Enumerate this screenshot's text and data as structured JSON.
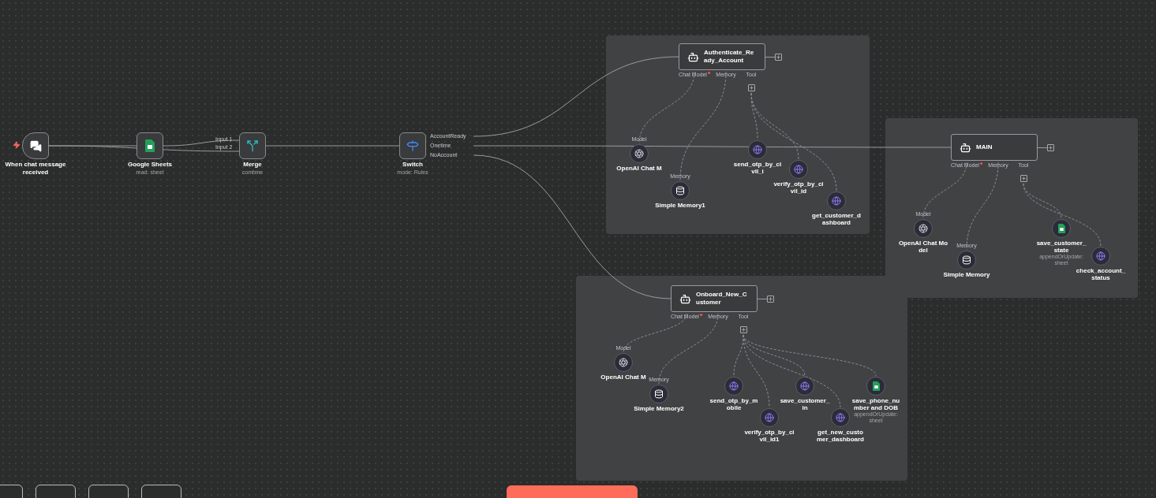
{
  "flow_nodes": [
    {
      "kind": "trigger",
      "label": "When chat message received"
    },
    {
      "kind": "sheets",
      "label": "Google Sheets",
      "subtitle": "read: sheet"
    },
    {
      "kind": "merge",
      "label": "Merge",
      "subtitle": "combine",
      "inputs": [
        "Input 1",
        "Input 2"
      ]
    },
    {
      "kind": "switch",
      "label": "Switch",
      "subtitle": "mode: Rules",
      "outputs": [
        "AccountReady",
        "Onetime",
        "NoAccount"
      ]
    }
  ],
  "groups": [
    {
      "agent": {
        "label": "Authenticate_Ready_Account",
        "ports": [
          {
            "label": "Chat Model",
            "required": true
          },
          {
            "label": "Memory",
            "required": false
          },
          {
            "label": "Tool",
            "required": false
          }
        ]
      },
      "tools": [
        {
          "kind": "model",
          "label": "OpenAI Chat M",
          "input_label": "Model"
        },
        {
          "kind": "memory",
          "label": "Simple Memory1",
          "input_label": "Memory"
        },
        {
          "kind": "http",
          "label": "send_otp_by_civil_i"
        },
        {
          "kind": "http",
          "label": "verify_otp_by_civil_id"
        },
        {
          "kind": "http",
          "label": "get_customer_dashboard"
        }
      ]
    },
    {
      "agent": {
        "label": "MAIN",
        "ports": [
          {
            "label": "Chat Model",
            "required": true
          },
          {
            "label": "Memory",
            "required": false
          },
          {
            "label": "Tool",
            "required": false
          }
        ]
      },
      "tools": [
        {
          "kind": "model",
          "label": "OpenAI Chat Model",
          "input_label": "Model"
        },
        {
          "kind": "memory",
          "label": "Simple Memory",
          "input_label": "Memory"
        },
        {
          "kind": "sheets",
          "label": "save_customer_state",
          "subtitle": "appendOrUpdate: sheet"
        },
        {
          "kind": "http",
          "label": "check_account_status"
        }
      ]
    },
    {
      "agent": {
        "label": "Onboard_New_Customer",
        "ports": [
          {
            "label": "Chat Model",
            "required": true
          },
          {
            "label": "Memory",
            "required": false
          },
          {
            "label": "Tool",
            "required": false
          }
        ]
      },
      "tools": [
        {
          "kind": "model",
          "label": "OpenAI Chat M",
          "input_label": "Model"
        },
        {
          "kind": "memory",
          "label": "Simple Memory2",
          "input_label": "Memory"
        },
        {
          "kind": "http",
          "label": "send_otp_by_mobile"
        },
        {
          "kind": "http",
          "label": "verify_otp_by_civil_id1"
        },
        {
          "kind": "http",
          "label": "save_customer_in"
        },
        {
          "kind": "http",
          "label": "get_new_customer_dashboard"
        },
        {
          "kind": "sheets",
          "label": "save_phone_number and DOB",
          "subtitle": "appendOrUpdate: sheet"
        }
      ]
    }
  ]
}
